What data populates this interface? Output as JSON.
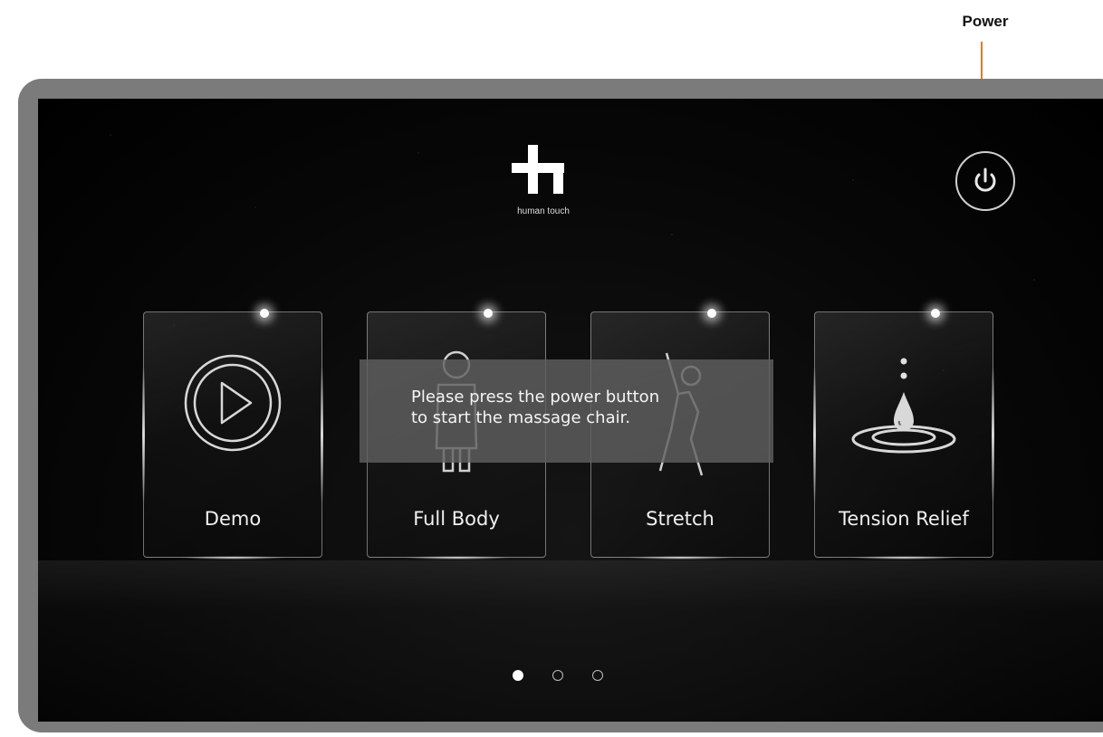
{
  "callout": {
    "power_label": "Power",
    "line_color": "#e07b2a"
  },
  "logo": {
    "text": "human touch"
  },
  "cards": [
    {
      "label": "Demo",
      "icon": "play-icon"
    },
    {
      "label": "Full Body",
      "icon": "person-icon"
    },
    {
      "label": "Stretch",
      "icon": "stretch-person-icon"
    },
    {
      "label": "Tension Relief",
      "icon": "water-drop-icon"
    }
  ],
  "message": {
    "line1": "Please press the power button",
    "line2": "to start the massage chair."
  },
  "pagination": {
    "pages": 3,
    "current": 1
  }
}
